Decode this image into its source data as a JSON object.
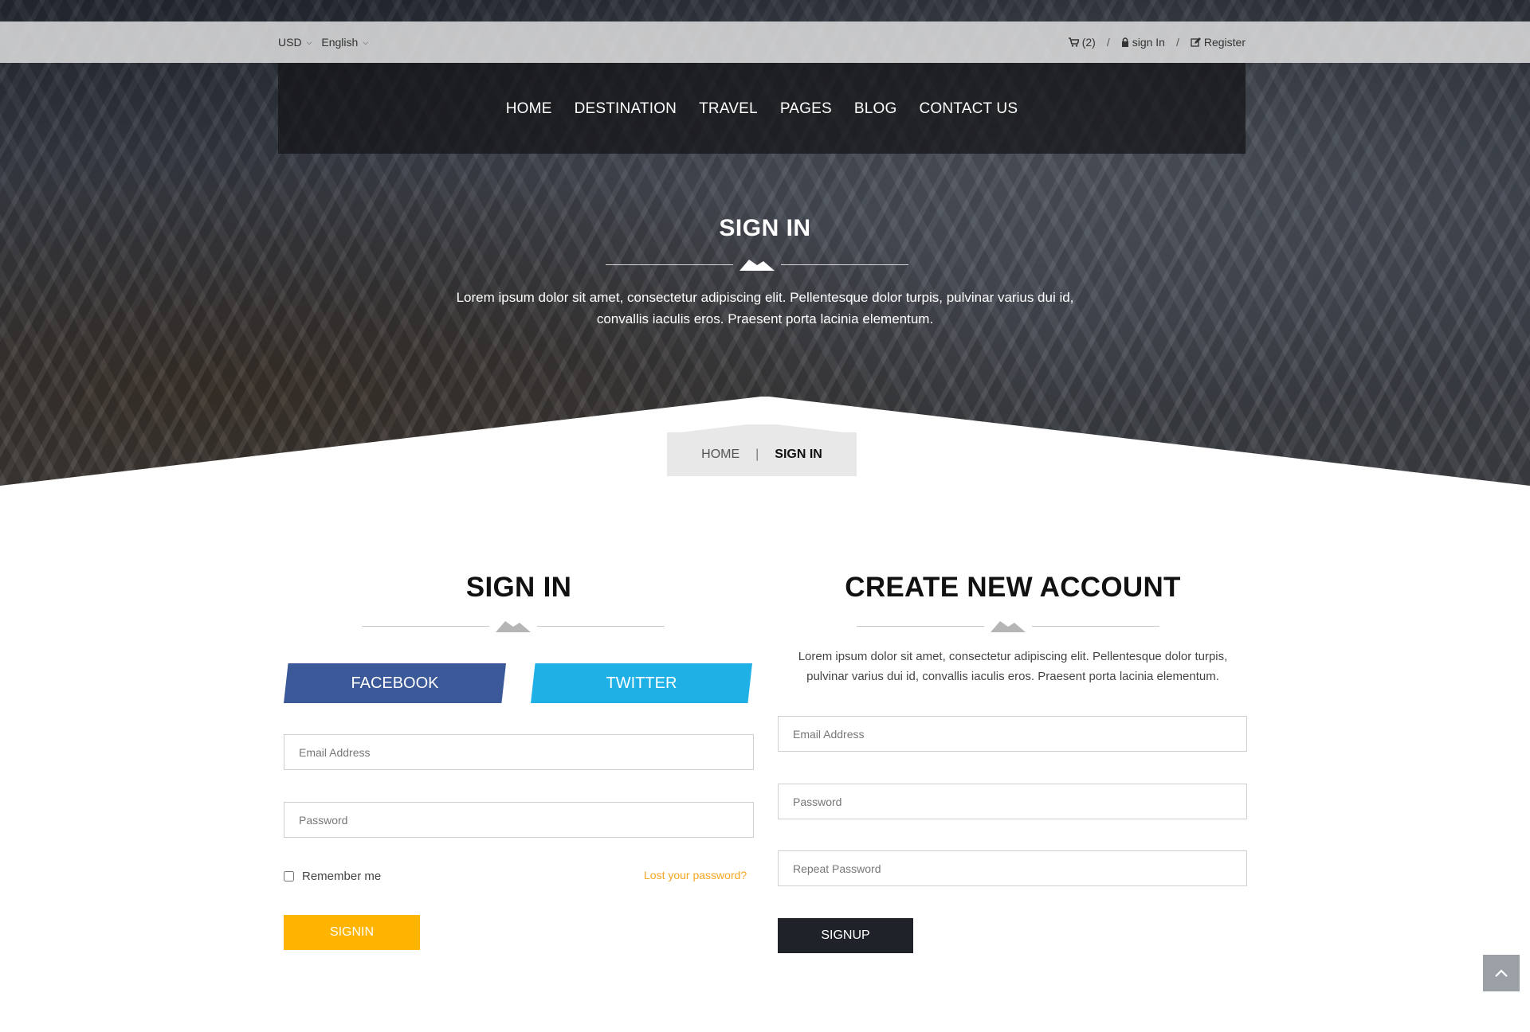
{
  "topbar": {
    "currency": "USD",
    "language": "English",
    "cart": "(2)",
    "signin": "sign In",
    "register": "Register",
    "separator": "/"
  },
  "nav": {
    "items": [
      "HOME",
      "DESTINATION",
      "TRAVEL",
      "PAGES",
      "BLOG",
      "CONTACT US"
    ]
  },
  "hero": {
    "title": "SIGN IN",
    "description": "Lorem ipsum dolor sit amet, consectetur adipiscing elit. Pellentesque dolor turpis, pulvinar varius dui id, convallis iaculis eros. Praesent porta lacinia elementum."
  },
  "breadcrumb": {
    "home": "HOME",
    "separator": "|",
    "current": "SIGN IN"
  },
  "signin": {
    "title": "SIGN IN",
    "facebook": "FACEBOOK",
    "twitter": "TWITTER",
    "email_placeholder": "Email Address",
    "password_placeholder": "Password",
    "remember": "Remember me",
    "lost_password": "Lost your password?",
    "button": "SIGNIN"
  },
  "signup": {
    "title": "CREATE NEW ACCOUNT",
    "description": "Lorem ipsum dolor sit amet, consectetur adipiscing elit. Pellentesque dolor turpis, pulvinar varius dui id, convallis iaculis eros. Praesent porta lacinia elementum.",
    "email_placeholder": "Email Address",
    "password_placeholder": "Password",
    "repeat_password_placeholder": "Repeat Password",
    "button": "SIGNUP"
  },
  "colors": {
    "facebook": "#3b5998",
    "twitter": "#1fb1e6",
    "signin_button": "#ffb400",
    "signup_button": "#1f2228",
    "link_accent": "#f5a623"
  },
  "icons": {
    "cart": "shopping-cart-icon",
    "lock": "lock-icon",
    "register": "edit-icon",
    "scroll_top": "chevron-up-icon",
    "divider": "mountain-icon"
  }
}
